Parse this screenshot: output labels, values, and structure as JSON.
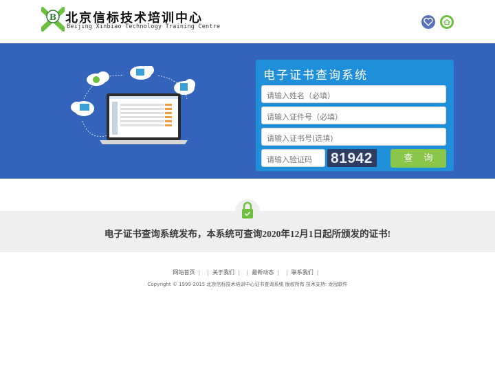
{
  "header": {
    "logo_cn": "北京信标技术培训中心",
    "logo_en": "Beijing Xinbiao Technology Training Centre",
    "icons": [
      "heart-icon",
      "home-icon"
    ],
    "colors": {
      "heart_bg": "#5a73b8",
      "home_bg": "#6cbf3f"
    }
  },
  "banner": {
    "background": "#3463bb",
    "query_panel": {
      "title": "电子证书查询系统",
      "name_placeholder": "请输入姓名（必填）",
      "id_placeholder": "请输入证件号（必填）",
      "cert_placeholder": "请输入证书号(选填)",
      "captcha_placeholder": "请输入验证码",
      "captcha_code": "81942",
      "submit_label": "查 询",
      "colors": {
        "panel": "#1f8fd9",
        "button": "#8ac64a"
      }
    }
  },
  "notice": {
    "icon": "lock-icon",
    "text": "电子证书查询系统发布，本系统可查询2020年12月1日起所颁发的证书!"
  },
  "footer": {
    "links": [
      "网站首页",
      "关于我们",
      "最新动态",
      "联系我们"
    ],
    "copyright": "Copyright © 1999-2015 北京信标技术培训中心证书查询系统 版权所有  技术支持: 龙冠软件"
  }
}
